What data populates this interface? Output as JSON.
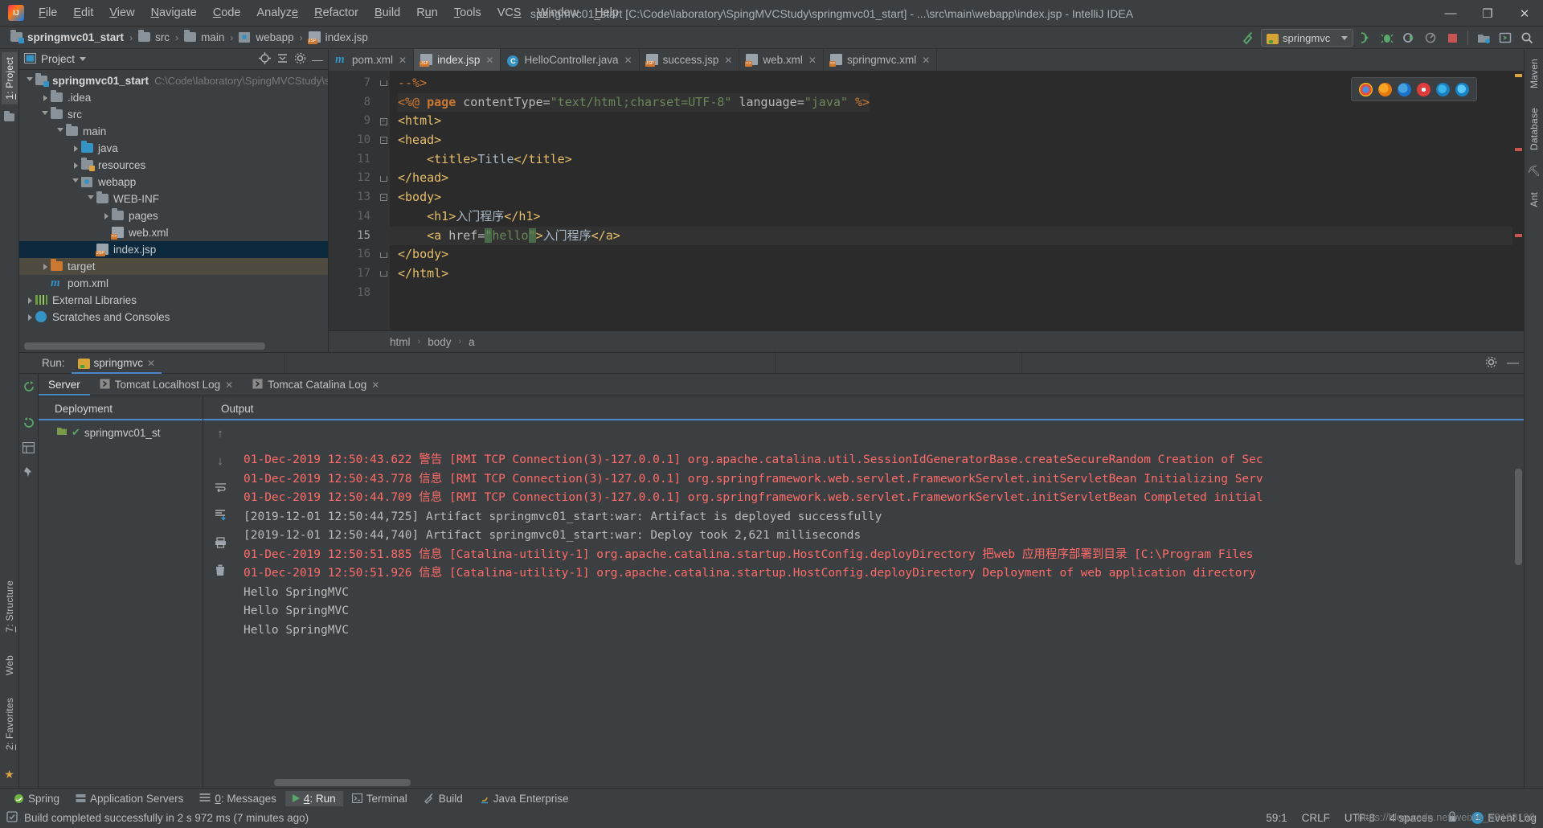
{
  "window": {
    "title": "springmvc01_start [C:\\Code\\laboratory\\SpingMVCStudy\\springmvc01_start] - ...\\src\\main\\webapp\\index.jsp - IntelliJ IDEA",
    "minimize": "—",
    "maximize": "❐",
    "close": "✕"
  },
  "menu": [
    "File",
    "Edit",
    "View",
    "Navigate",
    "Code",
    "Analyze",
    "Refactor",
    "Build",
    "Run",
    "Tools",
    "VCS",
    "Window",
    "Help"
  ],
  "breadcrumb": {
    "items": [
      "springmvc01_start",
      "src",
      "main",
      "webapp",
      "index.jsp"
    ]
  },
  "toolbar": {
    "run_config": "springmvc",
    "build_icon": "hammer-icon",
    "run_icon": "run-icon",
    "debug_icon": "debug-icon",
    "coverage_icon": "run-with-coverage-icon",
    "profile_icon": "profile-icon",
    "stop_icon": "stop-icon",
    "updatefolder_icon": "update-app-icon",
    "console_icon": "console-icon",
    "search_icon": "search-everywhere-icon"
  },
  "project_panel": {
    "title": "Project",
    "vertical_tab": "1: Project",
    "tree": [
      {
        "depth": 0,
        "arrow": "down",
        "icon": "module-folder",
        "label": "springmvc01_start",
        "bold": true,
        "sub": "C:\\Code\\laboratory\\SpingMVCStudy\\s",
        "state": "normal"
      },
      {
        "depth": 1,
        "arrow": "right",
        "icon": "folder",
        "label": ".idea",
        "bold": false,
        "sub": "",
        "state": "normal"
      },
      {
        "depth": 1,
        "arrow": "down",
        "icon": "folder",
        "label": "src",
        "bold": false,
        "sub": "",
        "state": "normal"
      },
      {
        "depth": 2,
        "arrow": "down",
        "icon": "folder",
        "label": "main",
        "bold": false,
        "sub": "",
        "state": "normal"
      },
      {
        "depth": 3,
        "arrow": "right",
        "icon": "folder-blue",
        "label": "java",
        "bold": false,
        "sub": "",
        "state": "normal"
      },
      {
        "depth": 3,
        "arrow": "right",
        "icon": "folder-resources",
        "label": "resources",
        "bold": false,
        "sub": "",
        "state": "normal"
      },
      {
        "depth": 3,
        "arrow": "down",
        "icon": "folder-web",
        "label": "webapp",
        "bold": false,
        "sub": "",
        "state": "normal"
      },
      {
        "depth": 4,
        "arrow": "down",
        "icon": "folder",
        "label": "WEB-INF",
        "bold": false,
        "sub": "",
        "state": "normal"
      },
      {
        "depth": 5,
        "arrow": "right",
        "icon": "folder",
        "label": "pages",
        "bold": false,
        "sub": "",
        "state": "normal"
      },
      {
        "depth": 5,
        "arrow": "none",
        "icon": "xml-file",
        "label": "web.xml",
        "bold": false,
        "sub": "",
        "state": "normal"
      },
      {
        "depth": 4,
        "arrow": "none",
        "icon": "jsp-file",
        "label": "index.jsp",
        "bold": false,
        "sub": "",
        "state": "selected"
      },
      {
        "depth": 1,
        "arrow": "right",
        "icon": "folder-orange",
        "label": "target",
        "bold": false,
        "sub": "",
        "state": "target"
      },
      {
        "depth": 1,
        "arrow": "none",
        "icon": "maven-file",
        "label": "pom.xml",
        "bold": false,
        "sub": "",
        "state": "normal"
      },
      {
        "depth": 0,
        "arrow": "right",
        "icon": "library",
        "label": "External Libraries",
        "bold": false,
        "sub": "",
        "state": "normal"
      },
      {
        "depth": 0,
        "arrow": "right",
        "icon": "scratches",
        "label": "Scratches and Consoles",
        "bold": false,
        "sub": "",
        "state": "normal"
      }
    ]
  },
  "editor": {
    "tabs": [
      {
        "label": "pom.xml",
        "icon": "maven-file",
        "active": false
      },
      {
        "label": "index.jsp",
        "icon": "jsp-file",
        "active": true
      },
      {
        "label": "HelloController.java",
        "icon": "java-class",
        "active": false
      },
      {
        "label": "success.jsp",
        "icon": "jsp-file",
        "active": false
      },
      {
        "label": "web.xml",
        "icon": "xml-file",
        "active": false
      },
      {
        "label": "springmvc.xml",
        "icon": "xml-file",
        "active": false
      }
    ],
    "lines": [
      {
        "no": "7",
        "fold": "end",
        "cur": false,
        "html": "<span class=\"cmt\">--%&gt;</span>"
      },
      {
        "no": "8",
        "fold": "none",
        "cur": false,
        "html": "<span class=\"jsp-bg\"><span class=\"cmt\">&lt;%@ </span><span class=\"kw\">page </span><span class=\"attr\">contentType=</span><span class=\"str\">\"text/html;charset=UTF-8\" </span><span class=\"attr\">language=</span><span class=\"str\">\"java\" </span><span class=\"cmt\">%&gt;</span></span>"
      },
      {
        "no": "9",
        "fold": "open",
        "cur": false,
        "html": "<span class=\"tagname\">&lt;html&gt;</span>"
      },
      {
        "no": "10",
        "fold": "open",
        "cur": false,
        "html": "<span class=\"tagname\">&lt;head&gt;</span>"
      },
      {
        "no": "11",
        "fold": "none",
        "cur": false,
        "html": "    <span class=\"tagname\">&lt;title&gt;</span><span class=\"txt\">Title</span><span class=\"tagname\">&lt;/title&gt;</span>"
      },
      {
        "no": "12",
        "fold": "end",
        "cur": false,
        "html": "<span class=\"tagname\">&lt;/head&gt;</span>"
      },
      {
        "no": "13",
        "fold": "open",
        "cur": false,
        "html": "<span class=\"tagname\">&lt;body&gt;</span>"
      },
      {
        "no": "14",
        "fold": "none",
        "cur": false,
        "html": "    <span class=\"tagname\">&lt;h1&gt;</span><span class=\"txt\">入门程序</span><span class=\"tagname\">&lt;/h1&gt;</span>"
      },
      {
        "no": "15",
        "fold": "none",
        "cur": true,
        "html": "    <span class=\"tagname\">&lt;a </span><span class=\"attr\">href=</span><span class=\"str strhl\">\"</span><span class=\"str\">hello</span><span class=\"str strhl\">\"</span><span class=\"tagname\">&gt;</span><span class=\"txt\">入门程序</span><span class=\"tagname\">&lt;/a&gt;</span>"
      },
      {
        "no": "16",
        "fold": "end",
        "cur": false,
        "html": "<span class=\"tagname\">&lt;/body&gt;</span>"
      },
      {
        "no": "17",
        "fold": "end",
        "cur": false,
        "html": "<span class=\"tagname\">&lt;/html&gt;</span>"
      },
      {
        "no": "18",
        "fold": "none",
        "cur": false,
        "html": ""
      }
    ],
    "browser_popup": [
      "chrome-icon",
      "firefox-dev-icon",
      "firefox-icon",
      "opera-icon",
      "edge-icon",
      "ie-icon"
    ],
    "breadcrumbs": [
      "html",
      "body",
      "a"
    ]
  },
  "run_panel": {
    "label": "Run:",
    "tab": "springmvc",
    "settings_icon": "gear-icon",
    "minimize_icon": "minimize-icon",
    "subtabs": [
      {
        "label": "Server",
        "icon": "",
        "active": true,
        "closable": false
      },
      {
        "label": "Tomcat Localhost Log",
        "icon": "log-icon",
        "active": false,
        "closable": true
      },
      {
        "label": "Tomcat Catalina Log",
        "icon": "log-icon",
        "active": false,
        "closable": true
      }
    ],
    "deployment": {
      "header": "Deployment",
      "artifact": "springmvc01_st"
    },
    "output": {
      "header": "Output",
      "lines": [
        {
          "error": true,
          "text": "01-Dec-2019 12:50:43.622 警告 [RMI TCP Connection(3)-127.0.0.1] org.apache.catalina.util.SessionIdGeneratorBase.createSecureRandom Creation of Sec"
        },
        {
          "error": true,
          "text": "01-Dec-2019 12:50:43.778 信息 [RMI TCP Connection(3)-127.0.0.1] org.springframework.web.servlet.FrameworkServlet.initServletBean Initializing Serv"
        },
        {
          "error": true,
          "text": "01-Dec-2019 12:50:44.709 信息 [RMI TCP Connection(3)-127.0.0.1] org.springframework.web.servlet.FrameworkServlet.initServletBean Completed initial"
        },
        {
          "error": false,
          "text": "[2019-12-01 12:50:44,725] Artifact springmvc01_start:war: Artifact is deployed successfully"
        },
        {
          "error": false,
          "text": "[2019-12-01 12:50:44,740] Artifact springmvc01_start:war: Deploy took 2,621 milliseconds"
        },
        {
          "error": true,
          "text": "01-Dec-2019 12:50:51.885 信息 [Catalina-utility-1] org.apache.catalina.startup.HostConfig.deployDirectory 把web 应用程序部署到目录 [C:\\Program Files"
        },
        {
          "error": true,
          "text": "01-Dec-2019 12:50:51.926 信息 [Catalina-utility-1] org.apache.catalina.startup.HostConfig.deployDirectory Deployment of web application directory"
        },
        {
          "error": false,
          "text": "Hello SpringMVC"
        },
        {
          "error": false,
          "text": "Hello SpringMVC"
        },
        {
          "error": false,
          "text": "Hello SpringMVC"
        }
      ]
    },
    "side_icons": [
      "rerun-icon",
      "stop-icon",
      "restart-icon",
      "layout-icon",
      "pin-icon"
    ],
    "console_icons": [
      "scroll-up-icon",
      "scroll-down-icon",
      "soft-wrap-icon",
      "scroll-to-end-icon",
      "print-icon",
      "clear-all-icon"
    ]
  },
  "left_strip": {
    "top": "1: Project",
    "bottom": [
      "7: Structure",
      "Web",
      "2: Favorites"
    ]
  },
  "right_strip": [
    "Maven",
    "Database",
    "Ant"
  ],
  "tool_windows": [
    {
      "label": "Spring",
      "icon": "spring-icon",
      "active": false
    },
    {
      "label": "Application Servers",
      "icon": "server-icon",
      "active": false
    },
    {
      "label": "0: Messages",
      "icon": "messages-icon",
      "active": false,
      "mnemonic": "0"
    },
    {
      "label": "4: Run",
      "icon": "run-icon",
      "active": true,
      "mnemonic": "4"
    },
    {
      "label": "Terminal",
      "icon": "terminal-icon",
      "active": false
    },
    {
      "label": "Build",
      "icon": "build-icon",
      "active": false
    },
    {
      "label": "Java Enterprise",
      "icon": "java-ee-icon",
      "active": false
    }
  ],
  "status_bar": {
    "message": "Build completed successfully in 2 s 972 ms (7 minutes ago)",
    "caret": "59:1",
    "line_sep": "CRLF",
    "encoding": "UTF-8",
    "indent": "4 spaces",
    "event_log": "Event Log",
    "event_count": "1",
    "lock_icon": "lock-icon",
    "build_icon": "build-status-icon"
  },
  "watermark": "https://blog.csdn.net/weixin_43168190",
  "colors": {
    "accent": "#4a88c7",
    "error": "#ff6b68",
    "selection": "#0d293e",
    "bg": "#3c3f41",
    "editor_bg": "#2b2b2b"
  }
}
